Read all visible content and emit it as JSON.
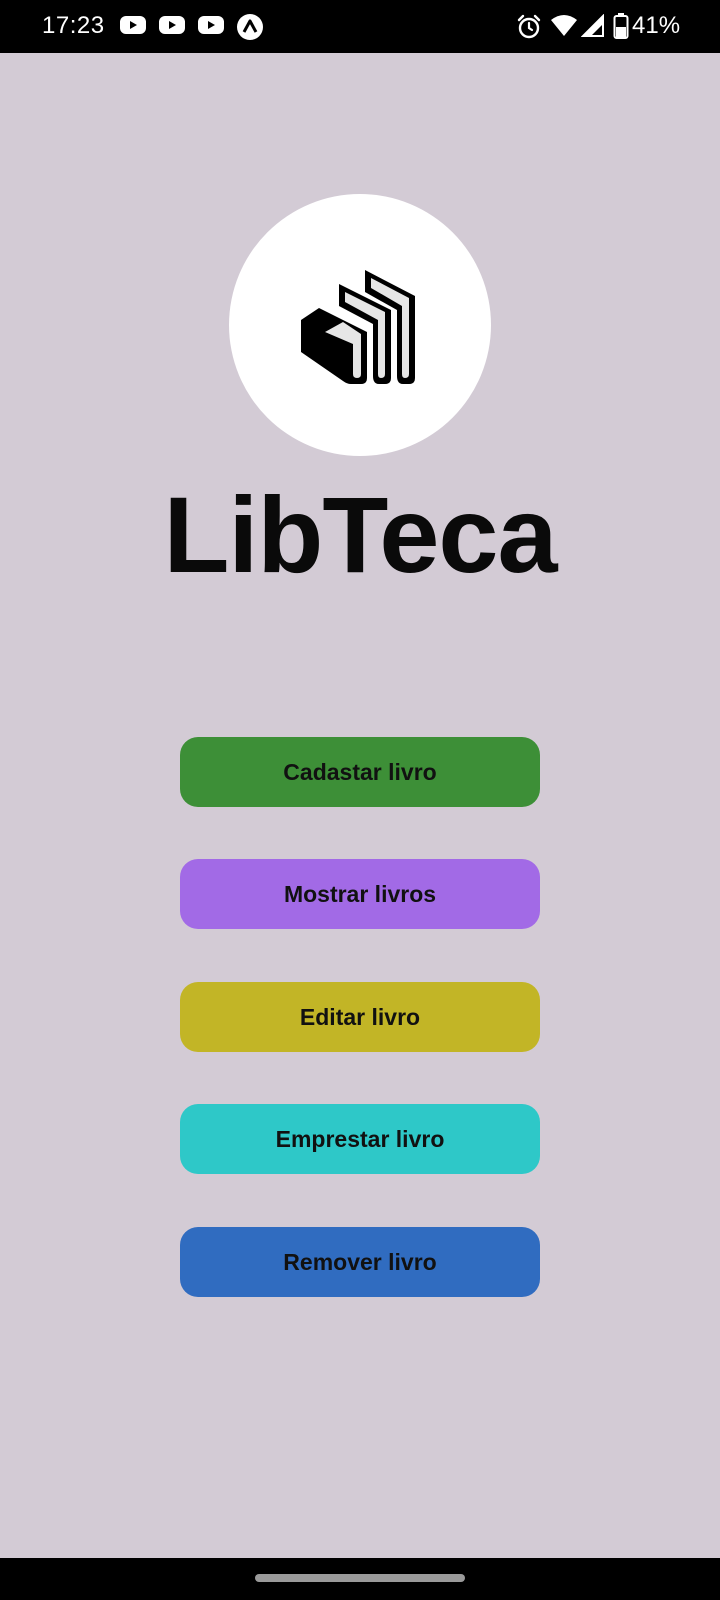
{
  "status_bar": {
    "time": "17:23",
    "notifications": [
      "youtube-icon",
      "youtube-icon",
      "youtube-icon",
      "app-notification-icon"
    ],
    "status_icons": [
      "alarm-icon",
      "wifi-icon",
      "signal-icon",
      "battery-icon"
    ],
    "battery": "41%"
  },
  "app": {
    "title": "LibTeca",
    "logo_icon": "books-logo-icon",
    "background": "#d3cbd5"
  },
  "menu": {
    "buttons": [
      {
        "label": "Cadastar livro",
        "color": "#3d8f37"
      },
      {
        "label": "Mostrar livros",
        "color": "#a26ae6"
      },
      {
        "label": "Editar livro",
        "color": "#c2b526"
      },
      {
        "label": "Emprestar livro",
        "color": "#2ec8c8"
      },
      {
        "label": "Remover livro",
        "color": "#306cc0"
      }
    ]
  }
}
